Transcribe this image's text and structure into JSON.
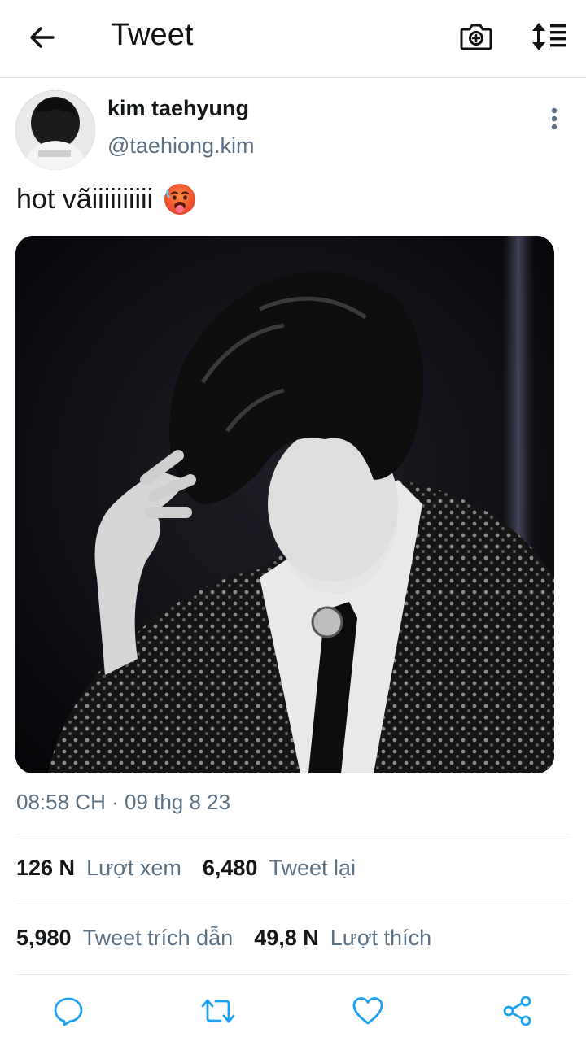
{
  "header": {
    "title": "Tweet",
    "back_icon": "arrow-left-icon",
    "camera_icon": "camera-add-icon",
    "sort_icon": "sort-list-icon"
  },
  "tweet": {
    "author_name": "kim taehyung",
    "author_handle": "@taehiong.kim",
    "text": "hot vãiiiiiiiiii",
    "emoji": "hot-face-emoji",
    "timestamp": "08:58 CH · 09 thg 8 23"
  },
  "stats": {
    "views_count": "126 N",
    "views_label": "Lượt xem",
    "retweets_count": "6,480",
    "retweets_label": "Tweet lại",
    "quotes_count": "5,980",
    "quotes_label": "Tweet trích dẫn",
    "likes_count": "49,8 N",
    "likes_label": "Lượt thích"
  },
  "actions": {
    "reply_icon": "reply-icon",
    "retweet_icon": "retweet-icon",
    "like_icon": "heart-icon",
    "share_icon": "share-icon"
  },
  "colors": {
    "text_primary": "#14171a",
    "text_secondary": "#5b7083",
    "divider": "#e3e6e8",
    "icon": "#1da1f2"
  }
}
